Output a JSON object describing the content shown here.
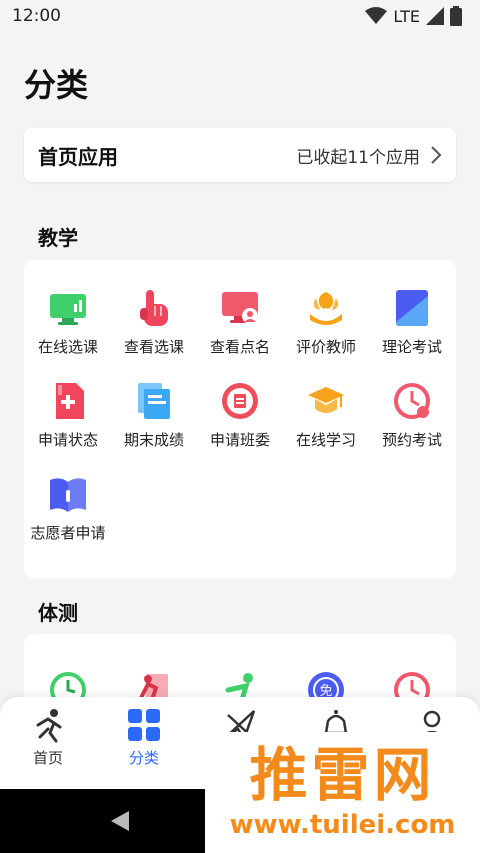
{
  "status_bar": {
    "time": "12:00",
    "network": "LTE"
  },
  "page_title": "分类",
  "apps_card": {
    "label": "首页应用",
    "status": "已收起11个应用"
  },
  "sections": {
    "teaching": {
      "title": "教学",
      "items": [
        {
          "label": "在线选课",
          "icon": "monitor-icon",
          "color": "#3fcf6b"
        },
        {
          "label": "查看选课",
          "icon": "hand-pointer-icon",
          "color": "#f0455b"
        },
        {
          "label": "查看点名",
          "icon": "screen-user-icon",
          "color": "#f0586c"
        },
        {
          "label": "评价教师",
          "icon": "flower-hands-icon",
          "color": "#f7a21b"
        },
        {
          "label": "理论考试",
          "icon": "book-icon",
          "color": "#4b5cf0"
        },
        {
          "label": "申请状态",
          "icon": "plus-doc-icon",
          "color": "#f0455b"
        },
        {
          "label": "期末成绩",
          "icon": "documents-icon",
          "color": "#3aa8f2"
        },
        {
          "label": "申请班委",
          "icon": "badge-icon",
          "color": "#ef4d5a"
        },
        {
          "label": "在线学习",
          "icon": "graduation-cap-icon",
          "color": "#f7a21b"
        },
        {
          "label": "预约考试",
          "icon": "clock-icon",
          "color": "#f0586c"
        },
        {
          "label": "志愿者申请",
          "icon": "open-book-icon",
          "color": "#4b5cf0"
        }
      ]
    },
    "fitness": {
      "title": "体测",
      "items": [
        {
          "icon": "green-clock-icon"
        },
        {
          "icon": "runner-doc-icon"
        },
        {
          "icon": "stretch-icon"
        },
        {
          "icon": "exempt-badge-icon"
        },
        {
          "icon": "pink-clock-icon"
        }
      ]
    }
  },
  "tabbar": {
    "tabs": [
      {
        "label": "首页",
        "icon": "runner-icon"
      },
      {
        "label": "分类",
        "icon": "grid-icon",
        "active": true
      },
      {
        "label": "",
        "icon": "plane-icon"
      },
      {
        "label": "",
        "icon": "bell-icon"
      },
      {
        "label": "",
        "icon": "user-icon"
      }
    ]
  },
  "watermark": {
    "big": "推雷网",
    "url": "www.tuilei.com"
  },
  "colors": {
    "accent": "#2b6af6",
    "watermark": "#f28b1c"
  }
}
